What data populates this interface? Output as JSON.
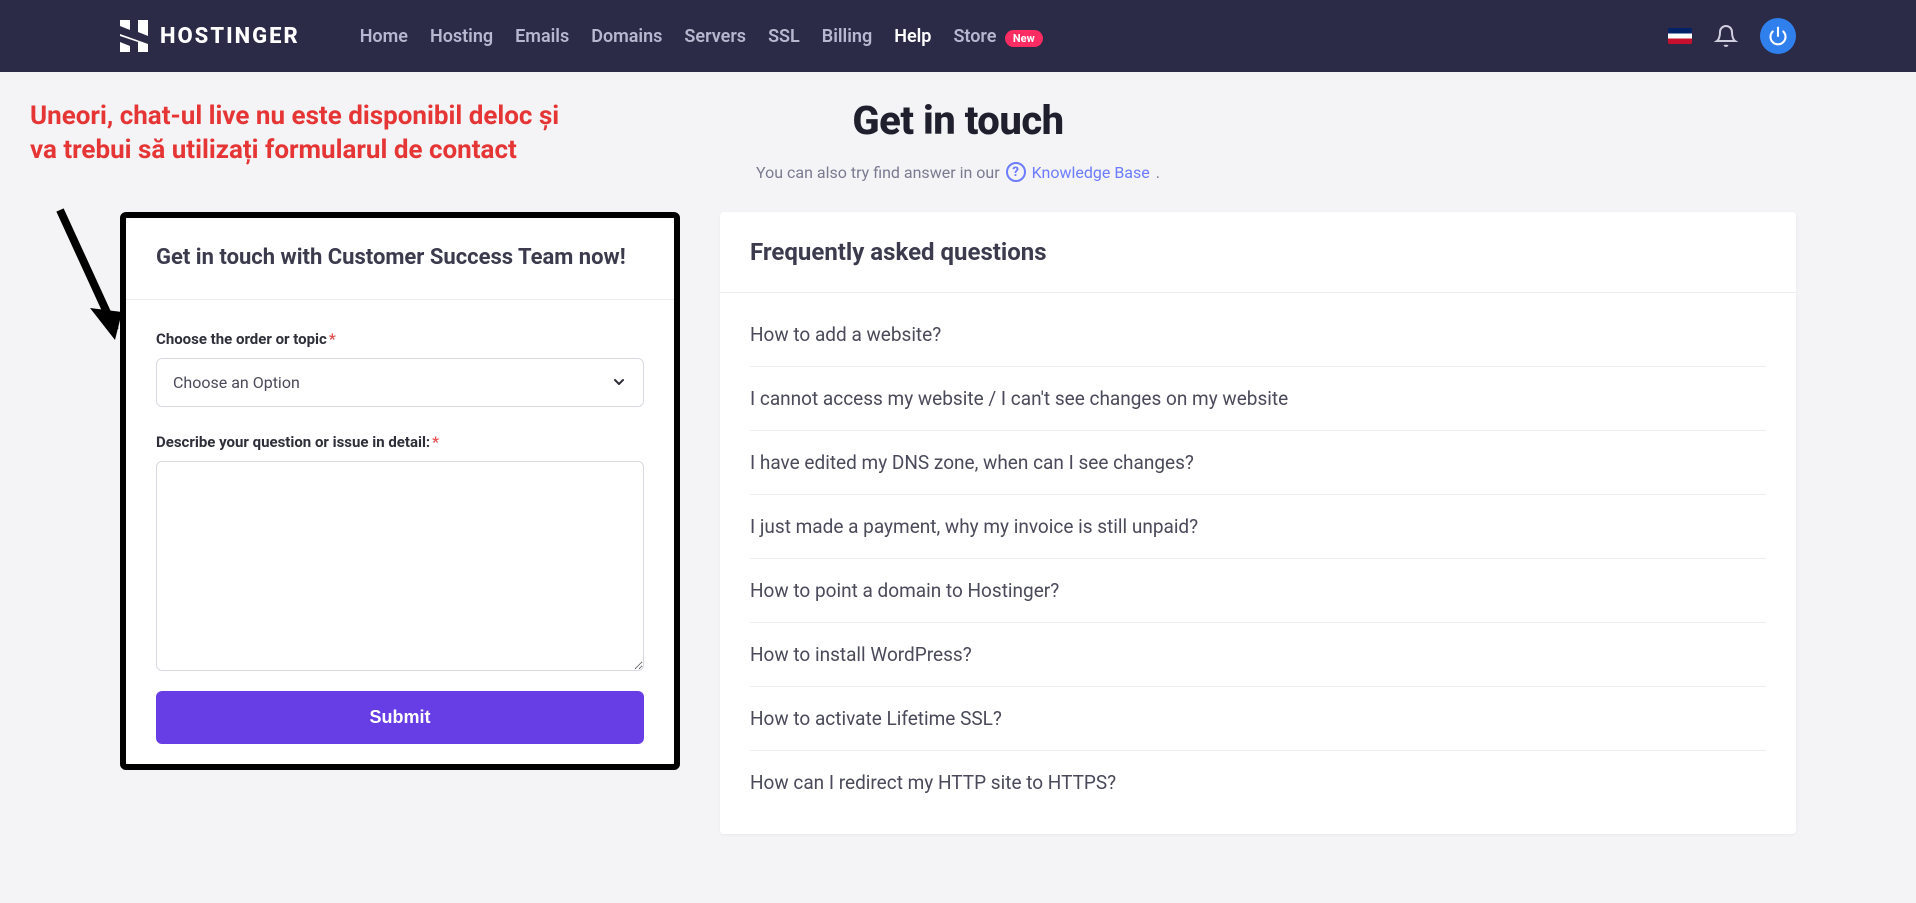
{
  "nav": {
    "brand": "HOSTINGER",
    "links": [
      {
        "label": "Home",
        "active": false
      },
      {
        "label": "Hosting",
        "active": false
      },
      {
        "label": "Emails",
        "active": false
      },
      {
        "label": "Domains",
        "active": false
      },
      {
        "label": "Servers",
        "active": false
      },
      {
        "label": "SSL",
        "active": false
      },
      {
        "label": "Billing",
        "active": false
      },
      {
        "label": "Help",
        "active": true
      },
      {
        "label": "Store",
        "active": false,
        "badge": "New"
      }
    ],
    "flag": "gb",
    "bell": "bell-icon",
    "power": "power-icon"
  },
  "annotation": {
    "text": "Uneori, chat-ul live nu este disponibil deloc și va trebui să utilizați formularul de contact"
  },
  "page": {
    "title": "Get in touch",
    "subtitle_prefix": "You can also try find answer in our",
    "kb_link": "Knowledge Base",
    "subtitle_suffix": "."
  },
  "form": {
    "header": "Get in touch with Customer Success Team now!",
    "topic_label": "Choose the order or topic",
    "topic_placeholder": "Choose an Option",
    "describe_label": "Describe your question or issue in detail:",
    "submit": "Submit"
  },
  "faq": {
    "header": "Frequently asked questions",
    "items": [
      "How to add a website?",
      "I cannot access my website / I can't see changes on my website",
      "I have edited my DNS zone, when can I see changes?",
      "I just made a payment, why my invoice is still unpaid?",
      "How to point a domain to Hostinger?",
      "How to install WordPress?",
      "How to activate Lifetime SSL?",
      "How can I redirect my HTTP site to HTTPS?"
    ]
  }
}
